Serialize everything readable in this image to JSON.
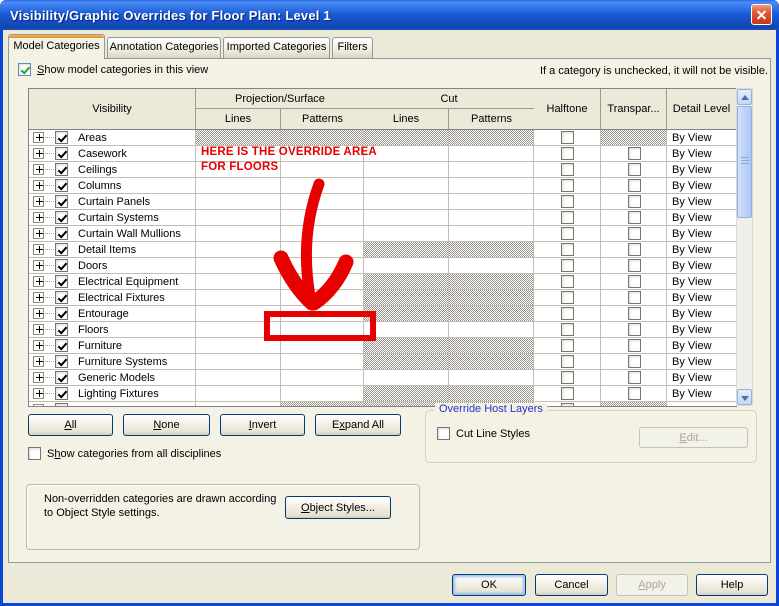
{
  "title": "Visibility/Graphic Overrides for Floor Plan: Level 1",
  "icons": {
    "close": "x-cross",
    "expand": "plus-box",
    "check": "checkmark",
    "scroll_up": "triangle-up",
    "scroll_down": "triangle-down"
  },
  "colors": {
    "titlebar_blue": "#1C5CD8",
    "annotation_red": "#E60000",
    "tab_accent_orange": "#E68B2C",
    "group_title_blue": "#2233CC"
  },
  "tabs": [
    {
      "label": "Model Categories",
      "active": true
    },
    {
      "label": "Annotation Categories",
      "active": false
    },
    {
      "label": "Imported Categories",
      "active": false
    },
    {
      "label": "Filters",
      "active": false
    }
  ],
  "view_toggle": {
    "label": "&Show model categories in this view",
    "checked": true
  },
  "note": "If a category is unchecked, it will not be visible.",
  "table": {
    "columns": {
      "visibility": "Visibility",
      "projection_surface": "Projection/Surface",
      "cut": "Cut",
      "lines": "Lines",
      "patterns": "Patterns",
      "halftone": "Halftone",
      "transparent": "Transpar...",
      "detail_level": "Detail Level"
    },
    "rows": [
      {
        "label": "Areas",
        "checked": true,
        "hatch": [
          "pl",
          "pp",
          "cl",
          "cp",
          "tr"
        ],
        "detail_level": "By View"
      },
      {
        "label": "Casework",
        "checked": true,
        "hatch": [],
        "detail_level": "By View"
      },
      {
        "label": "Ceilings",
        "checked": true,
        "hatch": [],
        "detail_level": "By View"
      },
      {
        "label": "Columns",
        "checked": true,
        "hatch": [],
        "detail_level": "By View"
      },
      {
        "label": "Curtain Panels",
        "checked": true,
        "hatch": [],
        "detail_level": "By View"
      },
      {
        "label": "Curtain Systems",
        "checked": true,
        "hatch": [],
        "detail_level": "By View"
      },
      {
        "label": "Curtain Wall Mullions",
        "checked": true,
        "hatch": [],
        "detail_level": "By View"
      },
      {
        "label": "Detail Items",
        "checked": true,
        "hatch": [
          "cl",
          "cp"
        ],
        "detail_level": "By View"
      },
      {
        "label": "Doors",
        "checked": true,
        "hatch": [],
        "detail_level": "By View"
      },
      {
        "label": "Electrical Equipment",
        "checked": true,
        "hatch": [
          "cl",
          "cp"
        ],
        "detail_level": "By View"
      },
      {
        "label": "Electrical Fixtures",
        "checked": true,
        "hatch": [
          "cl",
          "cp"
        ],
        "detail_level": "By View"
      },
      {
        "label": "Entourage",
        "checked": true,
        "hatch": [
          "cl",
          "cp"
        ],
        "detail_level": "By View"
      },
      {
        "label": "Floors",
        "checked": true,
        "hatch": [],
        "detail_level": "By View"
      },
      {
        "label": "Furniture",
        "checked": true,
        "hatch": [
          "cl",
          "cp"
        ],
        "detail_level": "By View"
      },
      {
        "label": "Furniture Systems",
        "checked": true,
        "hatch": [
          "cl",
          "cp"
        ],
        "detail_level": "By View"
      },
      {
        "label": "Generic Models",
        "checked": true,
        "hatch": [],
        "detail_level": "By View"
      },
      {
        "label": "Lighting Fixtures",
        "checked": true,
        "hatch": [
          "cl",
          "cp"
        ],
        "detail_level": "By View"
      },
      {
        "label": "",
        "checked": true,
        "hatch": [
          "pp",
          "cl",
          "cp",
          "tr"
        ],
        "detail_level": ""
      }
    ]
  },
  "buttons": {
    "all": "&All",
    "none": "&None",
    "invert": "&Invert",
    "expand_all": "E&xpand All"
  },
  "disciplines_toggle": {
    "label": "S&how categories from all disciplines",
    "checked": false
  },
  "override_host_layers": {
    "title": "Override Host Layers",
    "cut_line_styles_label": "Cut Line Styles",
    "cut_line_styles_checked": false,
    "edit_label": "&Edit...",
    "edit_enabled": false
  },
  "info_box": {
    "line1": "Non-overridden categories are drawn according",
    "line2": "to Object Style settings.",
    "object_styles_label": "&Object Styles..."
  },
  "footer": {
    "ok": "OK",
    "cancel": "Cancel",
    "apply": "&Apply",
    "apply_enabled": false,
    "help": "Help"
  },
  "annotation": {
    "line1": "HERE IS THE OVERRIDE AREA",
    "line2": "FOR FLOORS",
    "color": "#E60000"
  }
}
